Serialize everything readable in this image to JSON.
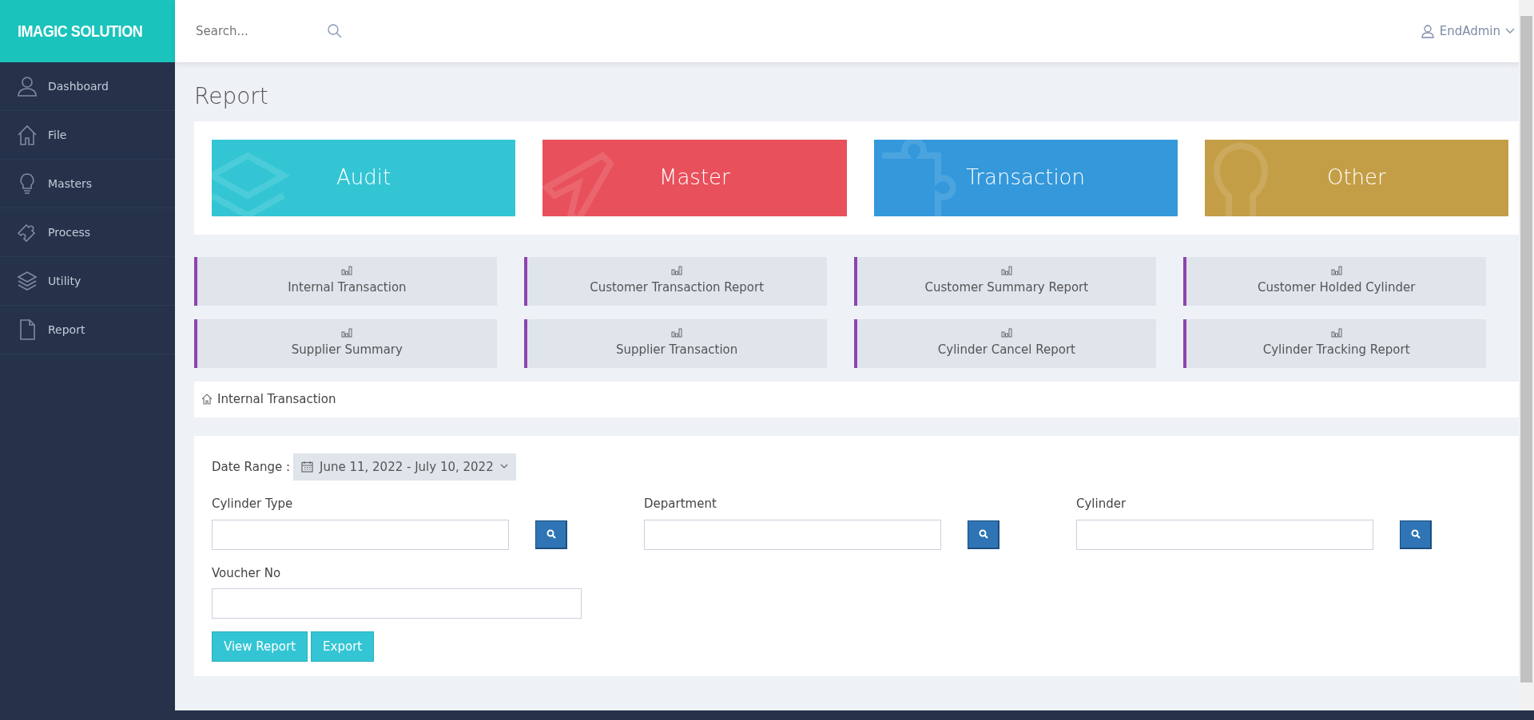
{
  "brand": {
    "title": "IMAGIC SOLUTION"
  },
  "header": {
    "search_placeholder": "Search...",
    "user": "EndAdmin"
  },
  "sidebar": {
    "items": [
      {
        "label": "Dashboard"
      },
      {
        "label": "File"
      },
      {
        "label": "Masters"
      },
      {
        "label": "Process"
      },
      {
        "label": "Utility"
      },
      {
        "label": "Report"
      }
    ]
  },
  "page_title": "Report",
  "categories": [
    {
      "label": "Audit",
      "color": "#33c5d4"
    },
    {
      "label": "Master",
      "color": "#e8505b"
    },
    {
      "label": "Transaction",
      "color": "#3498db"
    },
    {
      "label": "Other",
      "color": "#c49e47"
    }
  ],
  "reports": [
    {
      "label": "Internal Transaction"
    },
    {
      "label": "Customer Transaction Report"
    },
    {
      "label": "Customer Summary Report"
    },
    {
      "label": "Customer Holded Cylinder"
    },
    {
      "label": "Supplier Summary"
    },
    {
      "label": "Supplier Transaction"
    },
    {
      "label": "Cylinder Cancel Report"
    },
    {
      "label": "Cylinder Tracking Report"
    }
  ],
  "breadcrumb": "Internal Transaction",
  "form": {
    "date_label": "Date Range :",
    "date_value": "June 11, 2022 - July 10, 2022",
    "fields": [
      {
        "label": "Cylinder Type",
        "kind": "lookup"
      },
      {
        "label": "Department",
        "kind": "lookup"
      },
      {
        "label": "Cylinder",
        "kind": "lookup"
      },
      {
        "label": "Voucher No",
        "kind": "text"
      }
    ],
    "buttons": [
      "View Report",
      "Export"
    ]
  }
}
